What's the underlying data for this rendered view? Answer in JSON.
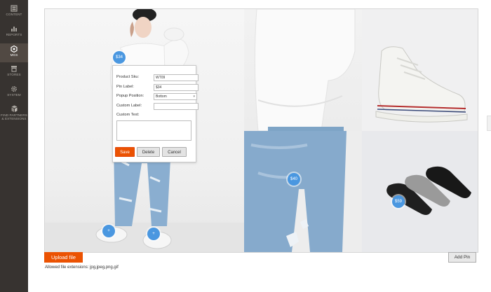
{
  "nav": {
    "items": [
      {
        "label": "CONTENT",
        "icon": "content-icon"
      },
      {
        "label": "REPORTS",
        "icon": "reports-icon"
      },
      {
        "label": "MGS",
        "icon": "mgs-hexagon-icon"
      },
      {
        "label": "STORES",
        "icon": "stores-icon"
      },
      {
        "label": "SYSTEM",
        "icon": "gear-icon"
      },
      {
        "label": "FIND PARTNERS\n& EXTENSIONS",
        "icon": "partners-cubes-icon"
      }
    ],
    "active": "MGS",
    "bg_color": "#373330",
    "active_color": "#514943"
  },
  "pins": {
    "pin_34": "$34",
    "pin_40": "$40",
    "pin_59": "$59",
    "pin_plus_1": "+",
    "pin_plus_2": "+",
    "pin_color": "#4a97e0"
  },
  "popup": {
    "product_sku_label": "Product Sku:",
    "product_sku_value": "WT09",
    "pin_label_label": "Pin Label:",
    "pin_label_value": "$34",
    "popup_position_label": "Popup Position:",
    "popup_position_value": "Bottom",
    "custom_label_label": "Custom Label:",
    "custom_label_value": "",
    "custom_text_label": "Custom Text:",
    "custom_text_value": "",
    "save_label": "Save",
    "delete_label": "Delete",
    "cancel_label": "Cancel"
  },
  "footer": {
    "upload_label": "Upload file",
    "allowed_text": "Allowed file extensions: jpg,jpeg,png,gif",
    "add_pin_label": "Add Pin"
  },
  "colors": {
    "accent": "#eb5202"
  }
}
